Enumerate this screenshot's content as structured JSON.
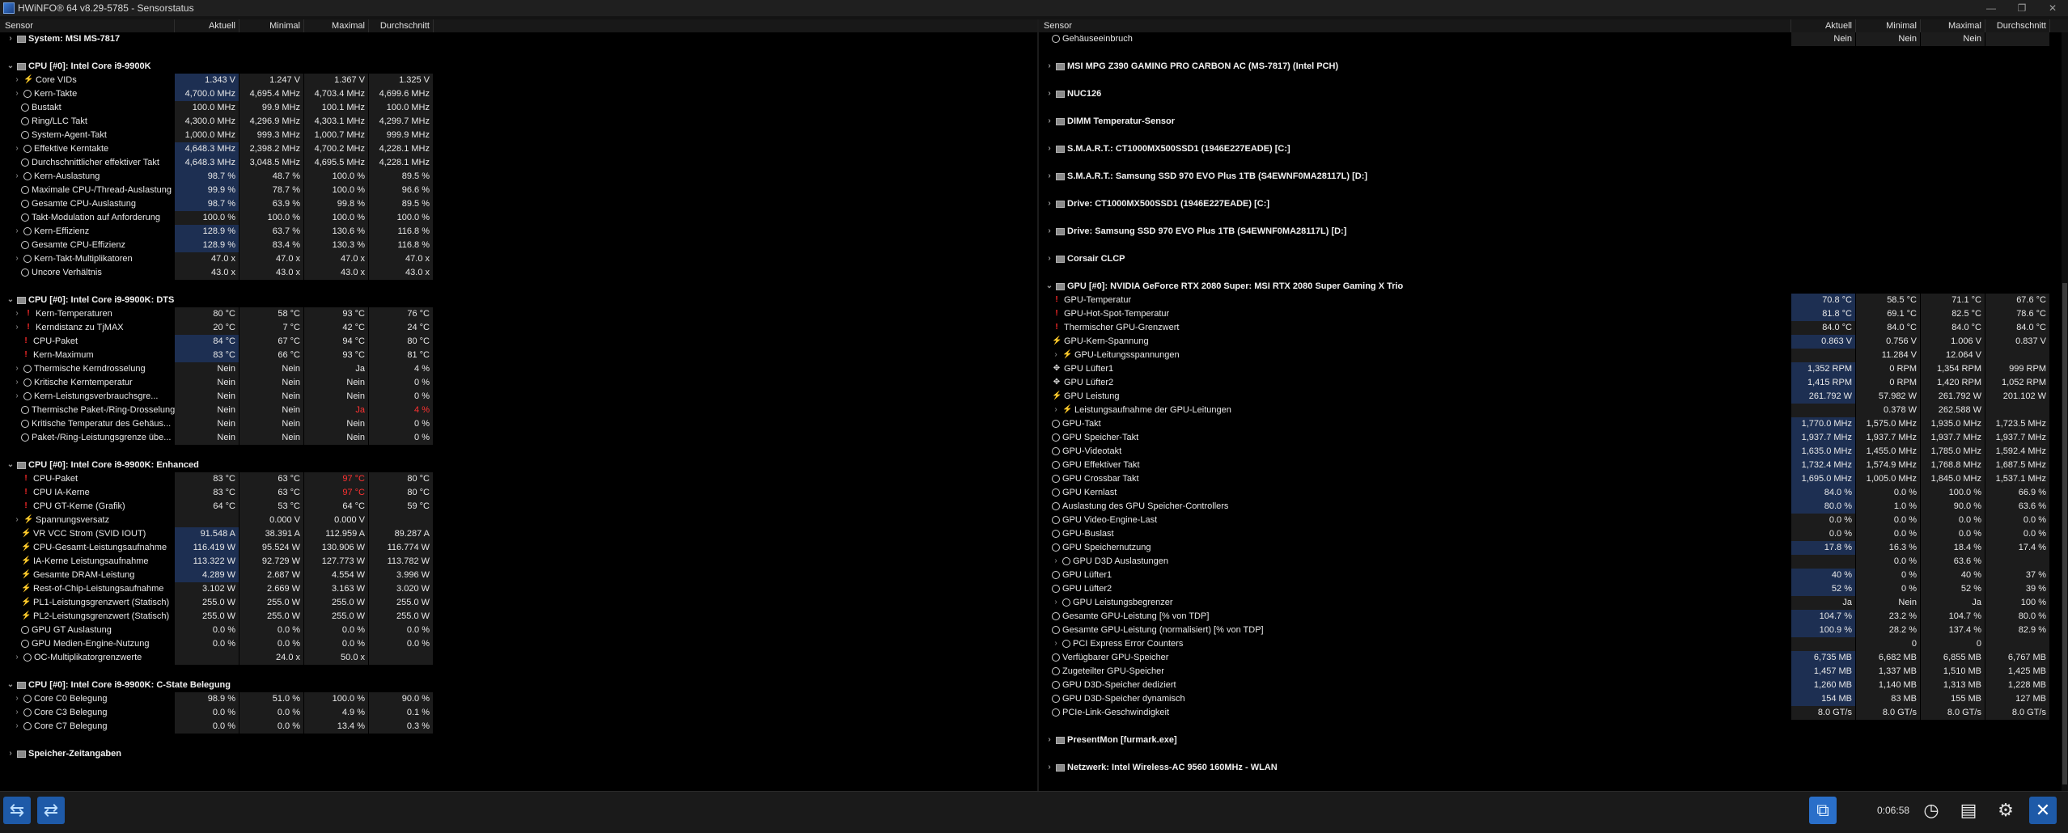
{
  "window": {
    "title": "HWiNFO® 64 v8.29-5785 - Sensorstatus",
    "controls": [
      "—",
      "❐",
      "✕"
    ]
  },
  "columns": {
    "sensor": "Sensor",
    "current": "Aktuell",
    "min": "Minimal",
    "max": "Maximal",
    "avg": "Durchschnitt"
  },
  "left_rows": [
    {
      "type": "group",
      "label": "System: MSI MS-7817",
      "exp": "›"
    },
    {
      "type": "gap"
    },
    {
      "type": "group",
      "label": "CPU [#0]: Intel Core i9-9900K",
      "exp": "⌄"
    },
    {
      "label": "Core VIDs",
      "icon": "bolt",
      "sub": true,
      "exp": "›",
      "v": [
        "1.343 V",
        "1.247 V",
        "1.367 V",
        "1.325 V"
      ],
      "hl": true
    },
    {
      "label": "Kern-Takte",
      "icon": "clock",
      "sub": true,
      "exp": "›",
      "v": [
        "4,700.0 MHz",
        "4,695.4 MHz",
        "4,703.4 MHz",
        "4,699.6 MHz"
      ],
      "hl": true
    },
    {
      "label": "Bustakt",
      "icon": "clock",
      "v": [
        "100.0 MHz",
        "99.9 MHz",
        "100.1 MHz",
        "100.0 MHz"
      ]
    },
    {
      "label": "Ring/LLC Takt",
      "icon": "clock",
      "v": [
        "4,300.0 MHz",
        "4,296.9 MHz",
        "4,303.1 MHz",
        "4,299.7 MHz"
      ]
    },
    {
      "label": "System-Agent-Takt",
      "icon": "clock",
      "v": [
        "1,000.0 MHz",
        "999.3 MHz",
        "1,000.7 MHz",
        "999.9 MHz"
      ]
    },
    {
      "label": "Effektive Kerntakte",
      "icon": "clock",
      "sub": true,
      "exp": "›",
      "v": [
        "4,648.3 MHz",
        "2,398.2 MHz",
        "4,700.2 MHz",
        "4,228.1 MHz"
      ],
      "hl": true
    },
    {
      "label": "Durchschnittlicher effektiver Takt",
      "icon": "clock",
      "v": [
        "4,648.3 MHz",
        "3,048.5 MHz",
        "4,695.5 MHz",
        "4,228.1 MHz"
      ],
      "hl": true
    },
    {
      "label": "Kern-Auslastung",
      "icon": "clock",
      "sub": true,
      "exp": "›",
      "v": [
        "98.7 %",
        "48.7 %",
        "100.0 %",
        "89.5 %"
      ],
      "hl": true
    },
    {
      "label": "Maximale CPU-/Thread-Auslastung",
      "icon": "clock",
      "v": [
        "99.9 %",
        "78.7 %",
        "100.0 %",
        "96.6 %"
      ],
      "hl": true
    },
    {
      "label": "Gesamte CPU-Auslastung",
      "icon": "clock",
      "v": [
        "98.7 %",
        "63.9 %",
        "99.8 %",
        "89.5 %"
      ],
      "hl": true
    },
    {
      "label": "Takt-Modulation auf Anforderung",
      "icon": "clock",
      "v": [
        "100.0 %",
        "100.0 %",
        "100.0 %",
        "100.0 %"
      ]
    },
    {
      "label": "Kern-Effizienz",
      "icon": "clock",
      "sub": true,
      "exp": "›",
      "v": [
        "128.9 %",
        "63.7 %",
        "130.6 %",
        "116.8 %"
      ],
      "hl": true
    },
    {
      "label": "Gesamte CPU-Effizienz",
      "icon": "clock",
      "v": [
        "128.9 %",
        "83.4 %",
        "130.3 %",
        "116.8 %"
      ],
      "hl": true
    },
    {
      "label": "Kern-Takt-Multiplikatoren",
      "icon": "clock",
      "sub": true,
      "exp": "›",
      "v": [
        "47.0 x",
        "47.0 x",
        "47.0 x",
        "47.0 x"
      ]
    },
    {
      "label": "Uncore Verhältnis",
      "icon": "clock",
      "v": [
        "43.0 x",
        "43.0 x",
        "43.0 x",
        "43.0 x"
      ]
    },
    {
      "type": "gap"
    },
    {
      "type": "group",
      "label": "CPU [#0]: Intel Core i9-9900K: DTS",
      "exp": "⌄"
    },
    {
      "label": "Kern-Temperaturen",
      "icon": "bang",
      "sub": true,
      "exp": "›",
      "v": [
        "80 °C",
        "58 °C",
        "93 °C",
        "76 °C"
      ]
    },
    {
      "label": "Kerndistanz zu TjMAX",
      "icon": "bang",
      "sub": true,
      "exp": "›",
      "v": [
        "20 °C",
        "7 °C",
        "42 °C",
        "24 °C"
      ]
    },
    {
      "label": "CPU-Paket",
      "icon": "bang",
      "v": [
        "84 °C",
        "67 °C",
        "94 °C",
        "80 °C"
      ],
      "hl": true
    },
    {
      "label": "Kern-Maximum",
      "icon": "bang",
      "v": [
        "83 °C",
        "66 °C",
        "93 °C",
        "81 °C"
      ],
      "hl": true
    },
    {
      "label": "Thermische Kerndrosselung",
      "icon": "clock",
      "sub": true,
      "exp": "›",
      "v": [
        "Nein",
        "Nein",
        "Ja",
        "4 %"
      ]
    },
    {
      "label": "Kritische Kerntemperatur",
      "icon": "clock",
      "sub": true,
      "exp": "›",
      "v": [
        "Nein",
        "Nein",
        "Nein",
        "0 %"
      ]
    },
    {
      "label": "Kern-Leistungsverbrauchsgre...",
      "icon": "clock",
      "sub": true,
      "exp": "›",
      "v": [
        "Nein",
        "Nein",
        "Nein",
        "0 %"
      ]
    },
    {
      "label": "Thermische Paket-/Ring-Drosselung",
      "icon": "clock",
      "v": [
        "Nein",
        "Nein",
        "Ja",
        "4 %"
      ],
      "red": [
        2,
        3
      ]
    },
    {
      "label": "Kritische Temperatur des Gehäus...",
      "icon": "clock",
      "v": [
        "Nein",
        "Nein",
        "Nein",
        "0 %"
      ]
    },
    {
      "label": "Paket-/Ring-Leistungsgrenze übe...",
      "icon": "clock",
      "v": [
        "Nein",
        "Nein",
        "Nein",
        "0 %"
      ]
    },
    {
      "type": "gap"
    },
    {
      "type": "group",
      "label": "CPU [#0]: Intel Core i9-9900K: Enhanced",
      "exp": "⌄"
    },
    {
      "label": "CPU-Paket",
      "icon": "bang",
      "v": [
        "83 °C",
        "63 °C",
        "97 °C",
        "80 °C"
      ],
      "red": [
        2
      ]
    },
    {
      "label": "CPU IA-Kerne",
      "icon": "bang",
      "v": [
        "83 °C",
        "63 °C",
        "97 °C",
        "80 °C"
      ],
      "red": [
        2
      ]
    },
    {
      "label": "CPU GT-Kerne (Grafik)",
      "icon": "bang",
      "v": [
        "64 °C",
        "53 °C",
        "64 °C",
        "59 °C"
      ]
    },
    {
      "label": "Spannungsversatz",
      "icon": "bolt",
      "sub": true,
      "exp": "›",
      "v": [
        "",
        "0.000 V",
        "0.000 V",
        ""
      ]
    },
    {
      "label": "VR VCC Strom (SVID IOUT)",
      "icon": "bolt",
      "v": [
        "91.548 A",
        "38.391 A",
        "112.959 A",
        "89.287 A"
      ],
      "hl": true
    },
    {
      "label": "CPU-Gesamt-Leistungsaufnahme",
      "icon": "bolt",
      "v": [
        "116.419 W",
        "95.524 W",
        "130.906 W",
        "116.774 W"
      ],
      "hl": true
    },
    {
      "label": "IA-Kerne Leistungsaufnahme",
      "icon": "bolt",
      "v": [
        "113.322 W",
        "92.729 W",
        "127.773 W",
        "113.782 W"
      ],
      "hl": true
    },
    {
      "label": "Gesamte DRAM-Leistung",
      "icon": "bolt",
      "v": [
        "4.289 W",
        "2.687 W",
        "4.554 W",
        "3.996 W"
      ],
      "hl": true
    },
    {
      "label": "Rest-of-Chip-Leistungsaufnahme",
      "icon": "bolt",
      "v": [
        "3.102 W",
        "2.669 W",
        "3.163 W",
        "3.020 W"
      ]
    },
    {
      "label": "PL1-Leistungsgrenzwert (Statisch)",
      "icon": "bolt",
      "v": [
        "255.0 W",
        "255.0 W",
        "255.0 W",
        "255.0 W"
      ]
    },
    {
      "label": "PL2-Leistungsgrenzwert (Statisch)",
      "icon": "bolt",
      "v": [
        "255.0 W",
        "255.0 W",
        "255.0 W",
        "255.0 W"
      ]
    },
    {
      "label": "GPU GT Auslastung",
      "icon": "clock",
      "v": [
        "0.0 %",
        "0.0 %",
        "0.0 %",
        "0.0 %"
      ]
    },
    {
      "label": "GPU Medien-Engine-Nutzung",
      "icon": "clock",
      "v": [
        "0.0 %",
        "0.0 %",
        "0.0 %",
        "0.0 %"
      ]
    },
    {
      "label": "OC-Multiplikatorgrenzwerte",
      "icon": "clock",
      "sub": true,
      "exp": "›",
      "v": [
        "",
        "24.0 x",
        "50.0 x",
        ""
      ]
    },
    {
      "type": "gap"
    },
    {
      "type": "group",
      "label": "CPU [#0]: Intel Core i9-9900K: C-State Belegung",
      "exp": "⌄"
    },
    {
      "label": "Core C0 Belegung",
      "icon": "clock",
      "sub": true,
      "exp": "›",
      "v": [
        "98.9 %",
        "51.0 %",
        "100.0 %",
        "90.0 %"
      ]
    },
    {
      "label": "Core C3 Belegung",
      "icon": "clock",
      "sub": true,
      "exp": "›",
      "v": [
        "0.0 %",
        "0.0 %",
        "4.9 %",
        "0.1 %"
      ]
    },
    {
      "label": "Core C7 Belegung",
      "icon": "clock",
      "sub": true,
      "exp": "›",
      "v": [
        "0.0 %",
        "0.0 %",
        "13.4 %",
        "0.3 %"
      ]
    },
    {
      "type": "gap"
    },
    {
      "type": "group",
      "label": "Speicher-Zeitangaben",
      "exp": "›"
    }
  ],
  "right_rows": [
    {
      "label": "Gehäuseeinbruch",
      "icon": "clock",
      "v": [
        "Nein",
        "Nein",
        "Nein",
        ""
      ]
    },
    {
      "type": "gap"
    },
    {
      "type": "group",
      "label": "MSI MPG Z390 GAMING PRO CARBON AC (MS-7817) (Intel PCH)",
      "exp": "›"
    },
    {
      "type": "gap"
    },
    {
      "type": "group",
      "label": "NUC126",
      "exp": "›"
    },
    {
      "type": "gap"
    },
    {
      "type": "group",
      "label": "DIMM Temperatur-Sensor",
      "exp": "›"
    },
    {
      "type": "gap"
    },
    {
      "type": "group",
      "label": "S.M.A.R.T.: CT1000MX500SSD1 (1946E227EADE) [C:]",
      "exp": "›"
    },
    {
      "type": "gap"
    },
    {
      "type": "group",
      "label": "S.M.A.R.T.: Samsung SSD 970 EVO Plus 1TB (S4EWNF0MA28117L) [D:]",
      "exp": "›"
    },
    {
      "type": "gap"
    },
    {
      "type": "group",
      "label": "Drive: CT1000MX500SSD1 (1946E227EADE) [C:]",
      "exp": "›"
    },
    {
      "type": "gap"
    },
    {
      "type": "group",
      "label": "Drive: Samsung SSD 970 EVO Plus 1TB (S4EWNF0MA28117L) [D:]",
      "exp": "›"
    },
    {
      "type": "gap"
    },
    {
      "type": "group",
      "label": "Corsair CLCP",
      "exp": "›"
    },
    {
      "type": "gap"
    },
    {
      "type": "group",
      "label": "GPU [#0]: NVIDIA GeForce RTX 2080 Super: MSI RTX 2080 Super Gaming X Trio",
      "exp": "⌄"
    },
    {
      "label": "GPU-Temperatur",
      "icon": "bang",
      "v": [
        "70.8 °C",
        "58.5 °C",
        "71.1 °C",
        "67.6 °C"
      ],
      "hl": true
    },
    {
      "label": "GPU-Hot-Spot-Temperatur",
      "icon": "bang",
      "v": [
        "81.8 °C",
        "69.1 °C",
        "82.5 °C",
        "78.6 °C"
      ],
      "hl": true
    },
    {
      "label": "Thermischer GPU-Grenzwert",
      "icon": "bang",
      "v": [
        "84.0 °C",
        "84.0 °C",
        "84.0 °C",
        "84.0 °C"
      ]
    },
    {
      "label": "GPU-Kern-Spannung",
      "icon": "bolt",
      "v": [
        "0.863 V",
        "0.756 V",
        "1.006 V",
        "0.837 V"
      ],
      "hl": true
    },
    {
      "label": "GPU-Leitungsspannungen",
      "icon": "bolt",
      "sub": true,
      "exp": "›",
      "v": [
        "",
        "11.284 V",
        "12.064 V",
        ""
      ]
    },
    {
      "label": "GPU Lüfter1",
      "icon": "fan",
      "v": [
        "1,352 RPM",
        "0 RPM",
        "1,354 RPM",
        "999 RPM"
      ],
      "hl": true
    },
    {
      "label": "GPU Lüfter2",
      "icon": "fan",
      "v": [
        "1,415 RPM",
        "0 RPM",
        "1,420 RPM",
        "1,052 RPM"
      ],
      "hl": true
    },
    {
      "label": "GPU Leistung",
      "icon": "bolt",
      "v": [
        "261.792 W",
        "57.982 W",
        "261.792 W",
        "201.102 W"
      ],
      "hl": true
    },
    {
      "label": "Leistungsaufnahme der GPU-Leitungen",
      "icon": "bolt",
      "sub": true,
      "exp": "›",
      "v": [
        "",
        "0.378 W",
        "262.588 W",
        ""
      ]
    },
    {
      "label": "GPU-Takt",
      "icon": "clock",
      "v": [
        "1,770.0 MHz",
        "1,575.0 MHz",
        "1,935.0 MHz",
        "1,723.5 MHz"
      ],
      "hl": true
    },
    {
      "label": "GPU Speicher-Takt",
      "icon": "clock",
      "v": [
        "1,937.7 MHz",
        "1,937.7 MHz",
        "1,937.7 MHz",
        "1,937.7 MHz"
      ],
      "hl": true
    },
    {
      "label": "GPU-Videotakt",
      "icon": "clock",
      "v": [
        "1,635.0 MHz",
        "1,455.0 MHz",
        "1,785.0 MHz",
        "1,592.4 MHz"
      ],
      "hl": true
    },
    {
      "label": "GPU Effektiver Takt",
      "icon": "clock",
      "v": [
        "1,732.4 MHz",
        "1,574.9 MHz",
        "1,768.8 MHz",
        "1,687.5 MHz"
      ],
      "hl": true
    },
    {
      "label": "GPU Crossbar Takt",
      "icon": "clock",
      "v": [
        "1,695.0 MHz",
        "1,005.0 MHz",
        "1,845.0 MHz",
        "1,537.1 MHz"
      ],
      "hl": true
    },
    {
      "label": "GPU Kernlast",
      "icon": "clock",
      "v": [
        "84.0 %",
        "0.0 %",
        "100.0 %",
        "66.9 %"
      ],
      "hl": true
    },
    {
      "label": "Auslastung des GPU Speicher-Controllers",
      "icon": "clock",
      "v": [
        "80.0 %",
        "1.0 %",
        "90.0 %",
        "63.6 %"
      ],
      "hl": true
    },
    {
      "label": "GPU Video-Engine-Last",
      "icon": "clock",
      "v": [
        "0.0 %",
        "0.0 %",
        "0.0 %",
        "0.0 %"
      ]
    },
    {
      "label": "GPU-Buslast",
      "icon": "clock",
      "v": [
        "0.0 %",
        "0.0 %",
        "0.0 %",
        "0.0 %"
      ]
    },
    {
      "label": "GPU Speichernutzung",
      "icon": "clock",
      "v": [
        "17.8 %",
        "16.3 %",
        "18.4 %",
        "17.4 %"
      ],
      "hl": true
    },
    {
      "label": "GPU D3D Auslastungen",
      "icon": "clock",
      "sub": true,
      "exp": "›",
      "v": [
        "",
        "0.0 %",
        "63.6 %",
        ""
      ]
    },
    {
      "label": "GPU Lüfter1",
      "icon": "clock",
      "v": [
        "40 %",
        "0 %",
        "40 %",
        "37 %"
      ],
      "hl": true
    },
    {
      "label": "GPU Lüfter2",
      "icon": "clock",
      "v": [
        "52 %",
        "0 %",
        "52 %",
        "39 %"
      ],
      "hl": true
    },
    {
      "label": "GPU Leistungsbegrenzer",
      "icon": "clock",
      "sub": true,
      "exp": "›",
      "v": [
        "Ja",
        "Nein",
        "Ja",
        "100 %"
      ]
    },
    {
      "label": "Gesamte GPU-Leistung [% von TDP]",
      "icon": "clock",
      "v": [
        "104.7 %",
        "23.2 %",
        "104.7 %",
        "80.0 %"
      ],
      "hl": true
    },
    {
      "label": "Gesamte GPU-Leistung (normalisiert) [% von TDP]",
      "icon": "clock",
      "v": [
        "100.9 %",
        "28.2 %",
        "137.4 %",
        "82.9 %"
      ],
      "hl": true
    },
    {
      "label": "PCI Express Error Counters",
      "icon": "clock",
      "sub": true,
      "exp": "›",
      "v": [
        "",
        "0",
        "0",
        ""
      ]
    },
    {
      "label": "Verfügbarer GPU-Speicher",
      "icon": "clock",
      "v": [
        "6,735 MB",
        "6,682 MB",
        "6,855 MB",
        "6,767 MB"
      ],
      "hl": true
    },
    {
      "label": "Zugeteilter GPU-Speicher",
      "icon": "clock",
      "v": [
        "1,457 MB",
        "1,337 MB",
        "1,510 MB",
        "1,425 MB"
      ],
      "hl": true
    },
    {
      "label": "GPU D3D-Speicher dediziert",
      "icon": "clock",
      "v": [
        "1,260 MB",
        "1,140 MB",
        "1,313 MB",
        "1,228 MB"
      ],
      "hl": true
    },
    {
      "label": "GPU D3D-Speicher dynamisch",
      "icon": "clock",
      "v": [
        "154 MB",
        "83 MB",
        "155 MB",
        "127 MB"
      ],
      "hl": true
    },
    {
      "label": "PCIe-Link-Geschwindigkeit",
      "icon": "clock",
      "v": [
        "8.0 GT/s",
        "8.0 GT/s",
        "8.0 GT/s",
        "8.0 GT/s"
      ]
    },
    {
      "type": "gap"
    },
    {
      "type": "group",
      "label": "PresentMon [furmark.exe]",
      "exp": "›"
    },
    {
      "type": "gap"
    },
    {
      "type": "group",
      "label": "Netzwerk: Intel Wireless-AC 9560 160MHz - WLAN",
      "exp": "›"
    }
  ],
  "statusbar": {
    "timer": "0:06:58",
    "icons": [
      "arrows-left-right-icon",
      "arrows-right-left-icon",
      "network-icon",
      "clock-icon",
      "report-icon",
      "settings-icon",
      "close-icon"
    ]
  }
}
